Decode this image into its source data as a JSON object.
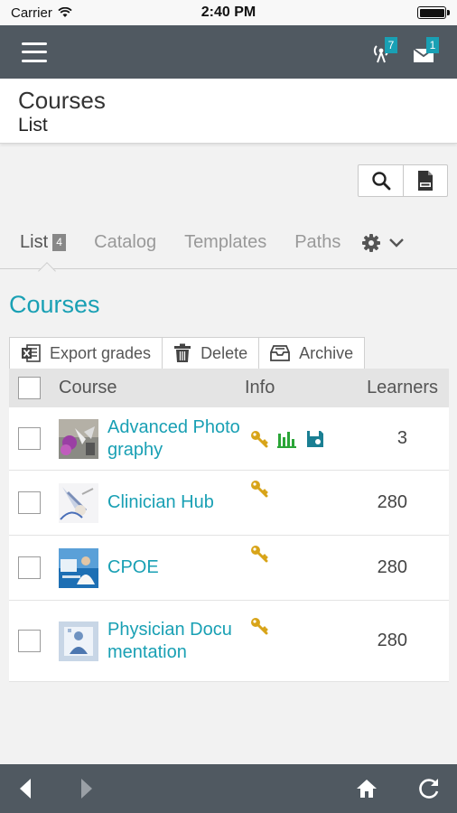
{
  "status_bar": {
    "carrier": "Carrier",
    "time": "2:40 PM"
  },
  "app_bar": {
    "notifications_badge": "7",
    "messages_badge": "1"
  },
  "header": {
    "title": "Courses",
    "subtitle": "List"
  },
  "toolbar": {
    "search_icon": "search-icon",
    "pdf_icon": "pdf-icon"
  },
  "tabs": [
    {
      "label": "List",
      "count": "4"
    },
    {
      "label": "Catalog"
    },
    {
      "label": "Templates"
    },
    {
      "label": "Paths"
    }
  ],
  "section": {
    "title": "Courses"
  },
  "actions": [
    {
      "label": "Export grades",
      "icon": "excel-icon"
    },
    {
      "label": "Delete",
      "icon": "trash-icon"
    },
    {
      "label": "Archive",
      "icon": "archive-icon"
    }
  ],
  "table": {
    "columns": {
      "course": "Course",
      "info": "Info",
      "learners": "Learners"
    },
    "rows": [
      {
        "course": "Advanced Photography",
        "learners": "3",
        "info": [
          "key-icon",
          "bar-chart-icon",
          "save-icon"
        ]
      },
      {
        "course": "Clinician Hub",
        "learners": "280",
        "info": [
          "key-icon"
        ]
      },
      {
        "course": "CPOE",
        "learners": "280",
        "info": [
          "key-icon"
        ]
      },
      {
        "course": "Physician Documentation",
        "learners": "280",
        "info": [
          "key-icon"
        ]
      }
    ]
  },
  "colors": {
    "accent": "#19a0b4",
    "bar": "#505961",
    "key": "#d8a419",
    "chart": "#2aa537"
  }
}
